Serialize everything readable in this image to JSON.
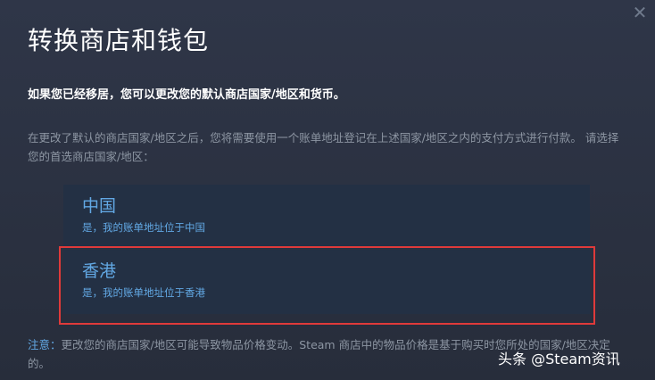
{
  "dialog": {
    "close_glyph": "✕",
    "title": "转换商店和钱包",
    "intro": "如果您已经移居，您可以更改您的默认商店国家/地区和货币。",
    "description": "在更改了默认的商店国家/地区之后，您将需要使用一个账单地址登记在上述国家/地区之内的支付方式进行付款。 请选择您的首选商店国家/地区：",
    "options": [
      {
        "name": "中国",
        "subtitle": "是，我的账单地址位于中国"
      },
      {
        "name": "香港",
        "subtitle": "是，我的账单地址位于香港"
      }
    ],
    "notice_label": "注意：",
    "notice_text": "更改您的商店国家/地区可能导致物品价格变动。Steam 商店中的物品价格是基于购买时您所处的国家/地区决定的。"
  },
  "watermark": "头条 @Steam资讯",
  "colors": {
    "background": "#2b3242",
    "option_bg": "#233044",
    "link_blue": "#62a8e4",
    "muted_text": "#8d96a3",
    "highlight_red": "#e03a3a"
  }
}
